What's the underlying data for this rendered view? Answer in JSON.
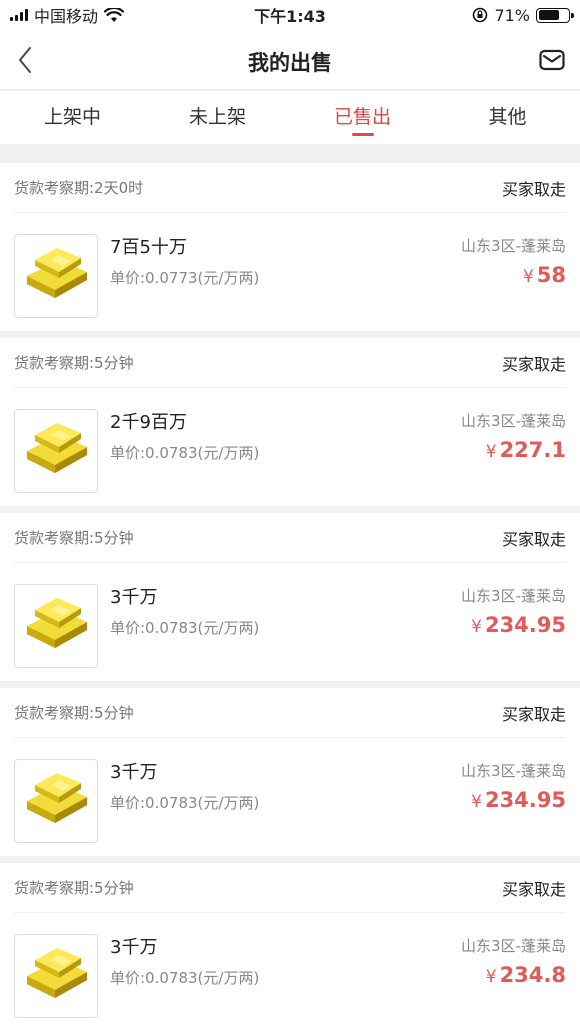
{
  "status_bar": {
    "carrier": "中国移动",
    "time": "下午1:43",
    "battery_percent": "71%",
    "battery_level": 0.71
  },
  "nav": {
    "title": "我的出售"
  },
  "tabs": [
    {
      "label": "上架中",
      "active": false
    },
    {
      "label": "未上架",
      "active": false
    },
    {
      "label": "已售出",
      "active": true
    },
    {
      "label": "其他",
      "active": false
    }
  ],
  "orders": [
    {
      "period": "货款考察期:2天0时",
      "status": "买家取走",
      "name": "7百5十万",
      "unit_price": "单价:0.0773(元/万两)",
      "server": "山东3区-蓬莱岛",
      "currency": "¥",
      "price": "58"
    },
    {
      "period": "货款考察期:5分钟",
      "status": "买家取走",
      "name": "2千9百万",
      "unit_price": "单价:0.0783(元/万两)",
      "server": "山东3区-蓬莱岛",
      "currency": "¥",
      "price": "227.1"
    },
    {
      "period": "货款考察期:5分钟",
      "status": "买家取走",
      "name": "3千万",
      "unit_price": "单价:0.0783(元/万两)",
      "server": "山东3区-蓬莱岛",
      "currency": "¥",
      "price": "234.95"
    },
    {
      "period": "货款考察期:5分钟",
      "status": "买家取走",
      "name": "3千万",
      "unit_price": "单价:0.0783(元/万两)",
      "server": "山东3区-蓬莱岛",
      "currency": "¥",
      "price": "234.95"
    },
    {
      "period": "货款考察期:5分钟",
      "status": "买家取走",
      "name": "3千万",
      "unit_price": "单价:0.0783(元/万两)",
      "server": "山东3区-蓬莱岛",
      "currency": "¥",
      "price": "234.8"
    }
  ],
  "icons": {
    "back": "chevron-left-icon",
    "mail": "mail-icon",
    "wifi": "wifi-icon",
    "lock_rotation": "rotation-lock-icon",
    "item_thumb": "gold-bar-icon"
  },
  "colors": {
    "accent": "#e0474a",
    "price": "#e05a5a"
  }
}
